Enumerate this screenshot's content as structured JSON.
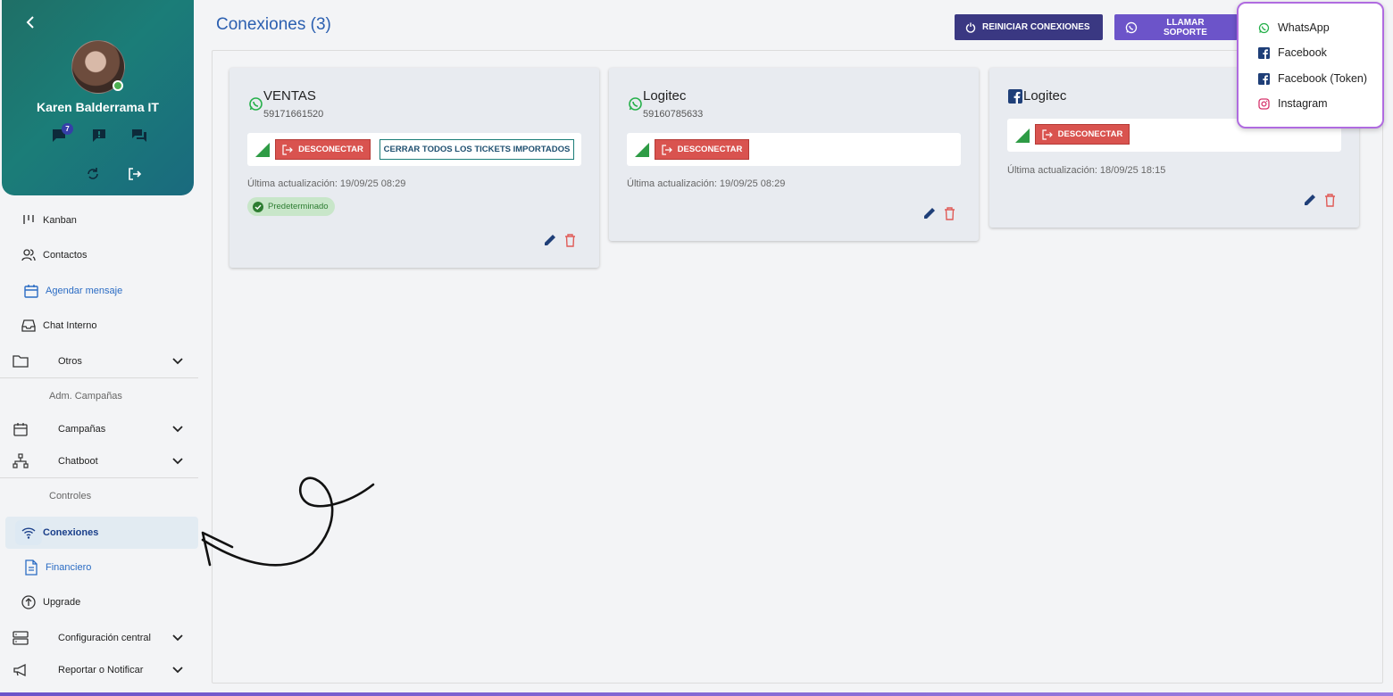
{
  "profile": {
    "name": "Karen Balderrama IT",
    "badge_count": "7"
  },
  "sidebar": {
    "items": [
      {
        "label": "Kanban",
        "icon": "kanban-icon"
      },
      {
        "label": "Contactos",
        "icon": "contacts-icon"
      },
      {
        "label": "Agendar mensaje",
        "icon": "calendar-icon"
      },
      {
        "label": "Chat Interno",
        "icon": "inbox-icon"
      },
      {
        "label": "Otros",
        "icon": "folder-icon"
      },
      {
        "label": "Campañas",
        "icon": "calendar-icon"
      },
      {
        "label": "Chatboot",
        "icon": "sitemap-icon"
      },
      {
        "label": "Conexiones",
        "icon": "wifi-icon"
      },
      {
        "label": "Financiero",
        "icon": "document-icon"
      },
      {
        "label": "Upgrade",
        "icon": "upgrade-icon"
      },
      {
        "label": "Configuración central",
        "icon": "server-icon"
      },
      {
        "label": "Reportar o Notificar",
        "icon": "megaphone-icon"
      }
    ],
    "sections": {
      "campaigns": "Adm. Campañas",
      "controls": "Controles"
    }
  },
  "header": {
    "title": "Conexiones (3)",
    "restart_label": "REINICIAR CONEXIONES",
    "support_label": "LLAMAR SOPORTE"
  },
  "connections": [
    {
      "name": "VENTAS",
      "phone": "59171661520",
      "channel": "whatsapp",
      "disconnect_label": "DESCONECTAR",
      "close_tickets_label": "CERRAR TODOS LOS TICKETS IMPORTADOS",
      "updated": "Última actualización: 19/09/25 08:29",
      "default_label": "Predeterminado"
    },
    {
      "name": "Logitec",
      "phone": "59160785633",
      "channel": "whatsapp",
      "disconnect_label": "DESCONECTAR",
      "updated": "Última actualización: 19/09/25 08:29"
    },
    {
      "name": "Logitec",
      "channel": "facebook",
      "disconnect_label": "DESCONECTAR",
      "updated": "Última actualización: 18/09/25 18:15"
    }
  ],
  "dropdown": {
    "items": [
      {
        "label": "WhatsApp",
        "icon": "whatsapp-icon"
      },
      {
        "label": "Facebook",
        "icon": "facebook-icon"
      },
      {
        "label": "Facebook (Token)",
        "icon": "facebook-icon"
      },
      {
        "label": "Instagram",
        "icon": "instagram-icon"
      }
    ]
  },
  "colors": {
    "profile_gradient": "#1b7d78",
    "title_blue": "#2b5fb0",
    "restart_btn": "#3a3882",
    "support_btn": "#6c54c9",
    "disconnect": "#d9534f",
    "dropdown_border": "#b06be0"
  }
}
